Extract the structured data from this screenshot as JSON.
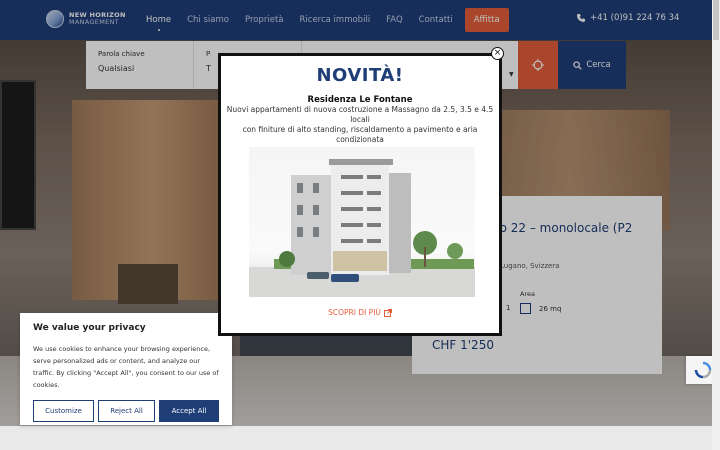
{
  "header": {
    "logo_line1": "NEW HORIZON",
    "logo_line2": "MANAGEMENT",
    "nav": [
      "Home",
      "Chi siamo",
      "Proprietà",
      "Ricerca immobili",
      "FAQ",
      "Contatti"
    ],
    "cta": "Affitta",
    "phone": "+41 (0)91 224 76 34"
  },
  "search": {
    "field1_label": "Parola chiave",
    "field1_value": "Qualsiasi",
    "field2_label_partial": "P",
    "field2_value_partial": "T",
    "search_button": "Cerca"
  },
  "card": {
    "title_partial": "go 22 – monolocale (P2",
    "location_partial": "Lugano, Svizzera",
    "rooms_partial": "1",
    "area_label": "Area",
    "area_value": "26 mq",
    "price": "CHF 1'250"
  },
  "modal": {
    "title": "NOVITÀ!",
    "subtitle": "Residenza Le Fontane",
    "text_line1": "Nuovi appartamenti di nuova costruzione a Massagno da 2.5, 3.5 e 4.5 locali",
    "text_line2": "con finiture di alto standing, riscaldamento a pavimento e aria condizionata",
    "link": "SCOPRI DI PIÙ"
  },
  "cookie": {
    "title": "We value your privacy",
    "text": "We use cookies to enhance your browsing experience, serve personalized ads or content, and analyze our traffic. By clicking \"Accept All\", you consent to our use of cookies.",
    "customize": "Customize",
    "reject": "Reject All",
    "accept": "Accept All"
  },
  "colors": {
    "brand_blue": "#1f3e78",
    "accent_orange": "#e35e3b"
  }
}
